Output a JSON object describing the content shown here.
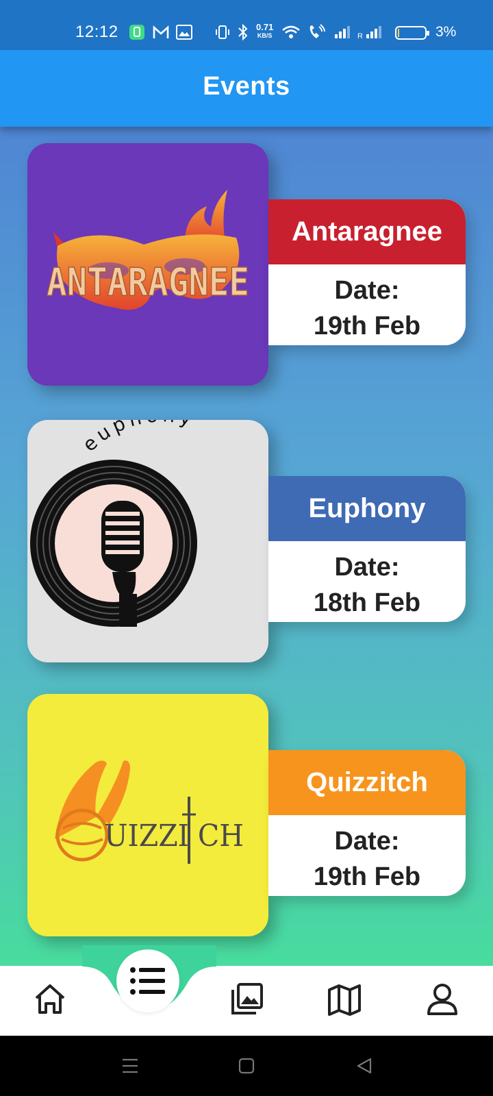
{
  "status_bar": {
    "time": "12:12",
    "net_speed_value": "0.71",
    "net_speed_unit": "KB/S",
    "battery_percent": "3%"
  },
  "app_bar": {
    "title": "Events"
  },
  "events": [
    {
      "name": "Antaragnee",
      "date_label": "Date:",
      "date": "19th Feb",
      "logo_text": "ANTARAGNEE",
      "header_color": "#c8202f",
      "logo_bg": "#6a38b8"
    },
    {
      "name": "Euphony",
      "date_label": "Date:",
      "date": "18th Feb",
      "logo_text": "euphony",
      "header_color": "#3f6ab4",
      "logo_bg": "#e2e2e2"
    },
    {
      "name": "Quizzitch",
      "date_label": "Date:",
      "date": "19th Feb",
      "logo_text": "UIZZI CH",
      "header_color": "#f7941d",
      "logo_bg": "#f3ec3d"
    }
  ],
  "bottom_nav": {
    "items": [
      {
        "icon": "home-icon"
      },
      {
        "icon": "list-icon",
        "active": true
      },
      {
        "icon": "gallery-icon"
      },
      {
        "icon": "map-icon"
      },
      {
        "icon": "profile-icon"
      }
    ],
    "accent_color": "#3ed39a"
  },
  "system_nav": {
    "buttons": [
      "menu",
      "home",
      "back"
    ]
  }
}
